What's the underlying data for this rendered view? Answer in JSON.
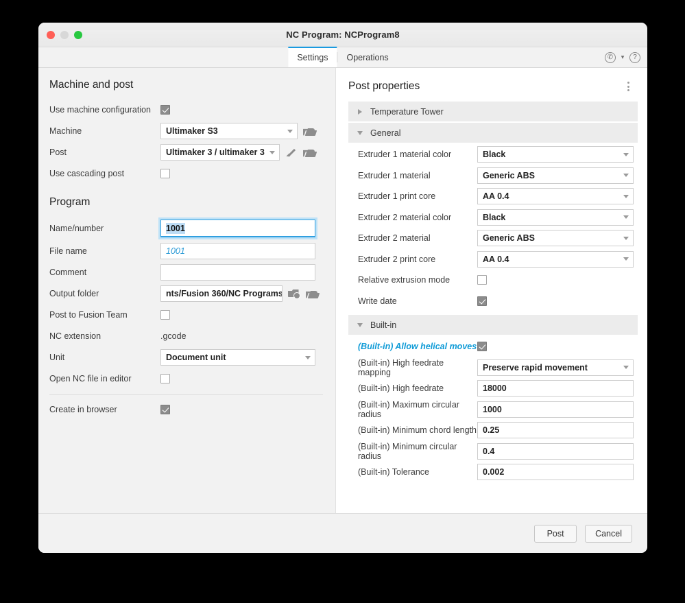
{
  "window": {
    "title": "NC Program: NCProgram8",
    "controls": {
      "close": "close",
      "minimize": "minimize",
      "zoom": "zoom"
    }
  },
  "tabs": [
    {
      "label": "Settings",
      "active": true
    },
    {
      "label": "Operations",
      "active": false
    }
  ],
  "titlebar_icons": {
    "support": "phone-support-icon",
    "chevron": "⌄",
    "help": "?"
  },
  "left": {
    "machine_section": {
      "heading": "Machine and post",
      "use_machine_configuration": {
        "label": "Use machine configuration",
        "checked": true
      },
      "machine": {
        "label": "Machine",
        "value": "Ultimaker S3"
      },
      "post": {
        "label": "Post",
        "value": "Ultimaker 3 / ultimaker 3"
      },
      "use_cascading_post": {
        "label": "Use cascading post",
        "checked": false
      }
    },
    "program_section": {
      "heading": "Program",
      "name_number": {
        "label": "Name/number",
        "value": "1001",
        "focused": true,
        "selected": true
      },
      "file_name": {
        "label": "File name",
        "value": "1001"
      },
      "comment": {
        "label": "Comment",
        "value": ""
      },
      "output_folder": {
        "label": "Output folder",
        "value": "nts/Fusion 360/NC Programs"
      },
      "post_to_fusion_team": {
        "label": "Post to Fusion Team",
        "checked": false
      },
      "nc_extension": {
        "label": "NC extension",
        "value": ".gcode"
      },
      "unit": {
        "label": "Unit",
        "value": "Document unit"
      },
      "open_nc_file_in_editor": {
        "label": "Open NC file in editor",
        "checked": false
      },
      "create_in_browser": {
        "label": "Create in browser",
        "checked": true
      }
    }
  },
  "right": {
    "heading": "Post properties",
    "groups": [
      {
        "name": "Temperature Tower",
        "expanded": false,
        "rows": []
      },
      {
        "name": "General",
        "expanded": true,
        "rows": [
          {
            "label": "Extruder 1 material color",
            "type": "dropdown",
            "value": "Black"
          },
          {
            "label": "Extruder 1 material",
            "type": "dropdown",
            "value": "Generic ABS"
          },
          {
            "label": "Extruder 1 print core",
            "type": "dropdown",
            "value": "AA 0.4"
          },
          {
            "label": "Extruder 2 material color",
            "type": "dropdown",
            "value": "Black"
          },
          {
            "label": "Extruder 2 material",
            "type": "dropdown",
            "value": "Generic ABS"
          },
          {
            "label": "Extruder 2 print core",
            "type": "dropdown",
            "value": "AA 0.4"
          },
          {
            "label": "Relative extrusion mode",
            "type": "checkbox",
            "checked": false
          },
          {
            "label": "Write date",
            "type": "checkbox",
            "checked": true
          }
        ]
      },
      {
        "name": "Built-in",
        "expanded": true,
        "rows": [
          {
            "label": "(Built-in) Allow helical moves",
            "type": "checkbox",
            "checked": true,
            "modified": true
          },
          {
            "label": "(Built-in) High feedrate mapping",
            "type": "dropdown",
            "value": "Preserve rapid movement"
          },
          {
            "label": "(Built-in) High feedrate",
            "type": "text",
            "value": "18000"
          },
          {
            "label": "(Built-in) Maximum circular radius",
            "type": "text",
            "value": "1000"
          },
          {
            "label": "(Built-in) Minimum chord length",
            "type": "text",
            "value": "0.25"
          },
          {
            "label": "(Built-in) Minimum circular radius",
            "type": "text",
            "value": "0.4"
          },
          {
            "label": "(Built-in) Tolerance",
            "type": "text",
            "value": "0.002"
          }
        ]
      }
    ]
  },
  "footer": {
    "post_label": "Post",
    "cancel_label": "Cancel"
  },
  "colors": {
    "accent": "#1a9ae0",
    "modified_label": "#0f9bd7",
    "window_bg": "#f2f2f2",
    "panel_bg": "#ffffff",
    "group_header_bg": "#ececec"
  }
}
